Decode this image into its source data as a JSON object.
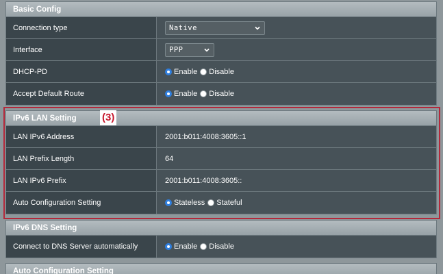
{
  "basic_config": {
    "title": "Basic Config",
    "connection_type": {
      "label": "Connection type",
      "value": "Native"
    },
    "interface": {
      "label": "Interface",
      "value": "PPP"
    },
    "dhcp_pd": {
      "label": "DHCP-PD",
      "opt1": "Enable",
      "opt2": "Disable",
      "selected": "Enable"
    },
    "accept_default_route": {
      "label": "Accept Default Route",
      "opt1": "Enable",
      "opt2": "Disable",
      "selected": "Enable"
    }
  },
  "ipv6_lan": {
    "title": "IPv6 LAN Setting",
    "annotation": "(3)",
    "lan_ipv6_address": {
      "label": "LAN IPv6 Address",
      "value": "2001:b011:4008:3605::1"
    },
    "lan_prefix_length": {
      "label": "LAN Prefix Length",
      "value": "64"
    },
    "lan_ipv6_prefix": {
      "label": "LAN IPv6 Prefix",
      "value": "2001:b011:4008:3605::"
    },
    "auto_config": {
      "label": "Auto Configuration Setting",
      "opt1": "Stateless",
      "opt2": "Stateful",
      "selected": "Stateless"
    }
  },
  "ipv6_dns": {
    "title": "IPv6 DNS Setting",
    "connect_dns_auto": {
      "label": "Connect to DNS Server automatically",
      "opt1": "Enable",
      "opt2": "Disable",
      "selected": "Enable"
    }
  },
  "auto_config_section": {
    "title": "Auto Configuration Setting"
  },
  "colors": {
    "radio_selected": "#2f7fe0",
    "highlight_border": "#b3283a",
    "annotation_text": "#c6162b"
  }
}
